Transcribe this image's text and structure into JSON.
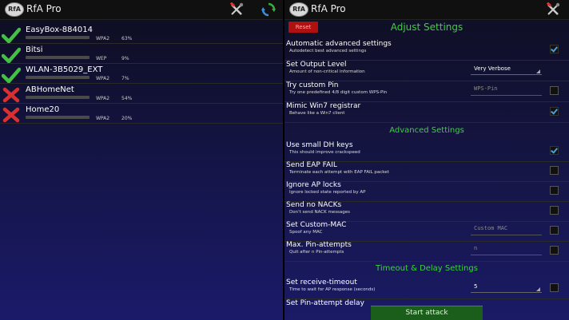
{
  "left_pane": {
    "app_title": "RfA Pro",
    "logo_text": "RfA",
    "networks": [
      {
        "ssid": "EasyBox-884014",
        "encryption": "WPA2",
        "signal": "63%",
        "status": "ok"
      },
      {
        "ssid": "Bitsi",
        "encryption": "WEP",
        "signal": "9%",
        "status": "ok"
      },
      {
        "ssid": "WLAN-3B5029_EXT",
        "encryption": "WPA2",
        "signal": "7%",
        "status": "ok"
      },
      {
        "ssid": "ABHomeNet",
        "encryption": "WPA2",
        "signal": "54%",
        "status": "fail"
      },
      {
        "ssid": "Home20",
        "encryption": "WPA2",
        "signal": "20%",
        "status": "fail"
      }
    ]
  },
  "right_pane": {
    "app_title": "RfA Pro",
    "logo_text": "RfA",
    "reset_label": "Reset",
    "adjust_title": "Adjust Settings",
    "advanced_title": "Advanced Settings",
    "timeout_title": "Timeout & Delay Settings",
    "start_label": "Start attack",
    "settings": {
      "auto_adv": {
        "title": "Automatic advanced settings",
        "subtitle": "Autodetect best advanced settings",
        "checked": true
      },
      "output": {
        "title": "Set Output Level",
        "subtitle": "Amount of non-critical information",
        "value": "Very Verbose"
      },
      "custom_pin": {
        "title": "Try custom Pin",
        "subtitle": "Try one predefined 4/8 digit custom WPS-Pin",
        "placeholder": "WPS-Pin",
        "checked": false
      },
      "win7": {
        "title": "Mimic Win7 registrar",
        "subtitle": "Behave like a Win7 client",
        "checked": true
      },
      "small_dh": {
        "title": "Use small DH keys",
        "subtitle": "This should improve crackspeed",
        "checked": true
      },
      "eap_fail": {
        "title": "Send EAP FAIL",
        "subtitle": "Terminate each attempt with EAP FAIL packet",
        "checked": false
      },
      "ignore_locks": {
        "title": "Ignore AP locks",
        "subtitle": "Ignore locked state reported by AP",
        "checked": false
      },
      "no_nacks": {
        "title": "Send no NACKs",
        "subtitle": "Don't send NACK messages",
        "checked": false
      },
      "custom_mac": {
        "title": "Set Custom-MAC",
        "subtitle": "Spoof any MAC",
        "placeholder": "Custom MAC",
        "checked": false
      },
      "max_pin": {
        "title": "Max. Pin-attempts",
        "subtitle": "Quit after n Pin-attempts",
        "placeholder": "n",
        "checked": false
      },
      "recv_timeout": {
        "title": "Set receive-timeout",
        "subtitle": "Time to wait for AP response (seconds)",
        "value": "5",
        "checked": false
      },
      "pin_delay": {
        "title": "Set Pin-attempt delay"
      }
    }
  },
  "colors": {
    "accent_green": "#3bd23b",
    "reset_red": "#b01010",
    "check_blue": "#4a9ede"
  }
}
